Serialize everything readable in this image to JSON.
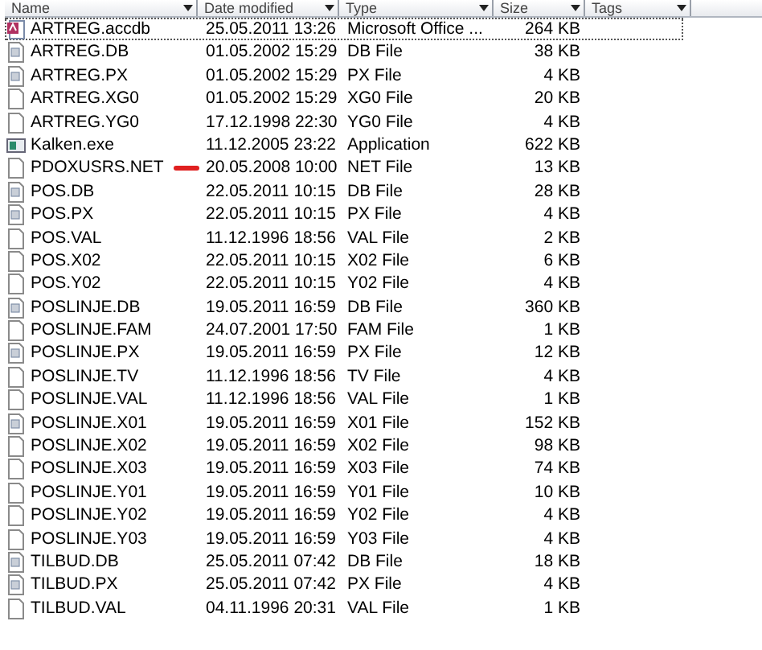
{
  "columns": [
    {
      "label": "Name"
    },
    {
      "label": "Date modified"
    },
    {
      "label": "Type"
    },
    {
      "label": "Size"
    },
    {
      "label": "Tags"
    }
  ],
  "rows": [
    {
      "name": "ARTREG.accdb",
      "date": "25.05.2011 13:26",
      "type": "Microsoft Office ...",
      "size": "264 KB",
      "kind": "access",
      "selected": true,
      "marked": false
    },
    {
      "name": "ARTREG.DB",
      "date": "01.05.2002 15:29",
      "type": "DB File",
      "size": "38 KB",
      "kind": "data",
      "selected": false,
      "marked": false
    },
    {
      "name": "ARTREG.PX",
      "date": "01.05.2002 15:29",
      "type": "PX File",
      "size": "4 KB",
      "kind": "data",
      "selected": false,
      "marked": false
    },
    {
      "name": "ARTREG.XG0",
      "date": "01.05.2002 15:29",
      "type": "XG0 File",
      "size": "20 KB",
      "kind": "blank",
      "selected": false,
      "marked": false
    },
    {
      "name": "ARTREG.YG0",
      "date": "17.12.1998 22:30",
      "type": "YG0 File",
      "size": "4 KB",
      "kind": "blank",
      "selected": false,
      "marked": false
    },
    {
      "name": "Kalken.exe",
      "date": "11.12.2005 23:22",
      "type": "Application",
      "size": "622 KB",
      "kind": "app",
      "selected": false,
      "marked": false
    },
    {
      "name": "PDOXUSRS.NET",
      "date": "20.05.2008 10:00",
      "type": "NET File",
      "size": "13 KB",
      "kind": "blank",
      "selected": false,
      "marked": true
    },
    {
      "name": "POS.DB",
      "date": "22.05.2011 10:15",
      "type": "DB File",
      "size": "28 KB",
      "kind": "data",
      "selected": false,
      "marked": false
    },
    {
      "name": "POS.PX",
      "date": "22.05.2011 10:15",
      "type": "PX File",
      "size": "4 KB",
      "kind": "data",
      "selected": false,
      "marked": false
    },
    {
      "name": "POS.VAL",
      "date": "11.12.1996 18:56",
      "type": "VAL File",
      "size": "2 KB",
      "kind": "blank",
      "selected": false,
      "marked": false
    },
    {
      "name": "POS.X02",
      "date": "22.05.2011 10:15",
      "type": "X02 File",
      "size": "6 KB",
      "kind": "blank",
      "selected": false,
      "marked": false
    },
    {
      "name": "POS.Y02",
      "date": "22.05.2011 10:15",
      "type": "Y02 File",
      "size": "4 KB",
      "kind": "blank",
      "selected": false,
      "marked": false
    },
    {
      "name": "POSLINJE.DB",
      "date": "19.05.2011 16:59",
      "type": "DB File",
      "size": "360 KB",
      "kind": "data",
      "selected": false,
      "marked": false
    },
    {
      "name": "POSLINJE.FAM",
      "date": "24.07.2001 17:50",
      "type": "FAM File",
      "size": "1 KB",
      "kind": "blank",
      "selected": false,
      "marked": false
    },
    {
      "name": "POSLINJE.PX",
      "date": "19.05.2011 16:59",
      "type": "PX File",
      "size": "12 KB",
      "kind": "data",
      "selected": false,
      "marked": false
    },
    {
      "name": "POSLINJE.TV",
      "date": "11.12.1996 18:56",
      "type": "TV File",
      "size": "4 KB",
      "kind": "blank",
      "selected": false,
      "marked": false
    },
    {
      "name": "POSLINJE.VAL",
      "date": "11.12.1996 18:56",
      "type": "VAL File",
      "size": "1 KB",
      "kind": "blank",
      "selected": false,
      "marked": false
    },
    {
      "name": "POSLINJE.X01",
      "date": "19.05.2011 16:59",
      "type": "X01 File",
      "size": "152 KB",
      "kind": "data",
      "selected": false,
      "marked": false
    },
    {
      "name": "POSLINJE.X02",
      "date": "19.05.2011 16:59",
      "type": "X02 File",
      "size": "98 KB",
      "kind": "blank",
      "selected": false,
      "marked": false
    },
    {
      "name": "POSLINJE.X03",
      "date": "19.05.2011 16:59",
      "type": "X03 File",
      "size": "74 KB",
      "kind": "blank",
      "selected": false,
      "marked": false
    },
    {
      "name": "POSLINJE.Y01",
      "date": "19.05.2011 16:59",
      "type": "Y01 File",
      "size": "10 KB",
      "kind": "blank",
      "selected": false,
      "marked": false
    },
    {
      "name": "POSLINJE.Y02",
      "date": "19.05.2011 16:59",
      "type": "Y02 File",
      "size": "4 KB",
      "kind": "blank",
      "selected": false,
      "marked": false
    },
    {
      "name": "POSLINJE.Y03",
      "date": "19.05.2011 16:59",
      "type": "Y03 File",
      "size": "4 KB",
      "kind": "blank",
      "selected": false,
      "marked": false
    },
    {
      "name": "TILBUD.DB",
      "date": "25.05.2011 07:42",
      "type": "DB File",
      "size": "18 KB",
      "kind": "data",
      "selected": false,
      "marked": false
    },
    {
      "name": "TILBUD.PX",
      "date": "25.05.2011 07:42",
      "type": "PX File",
      "size": "4 KB",
      "kind": "data",
      "selected": false,
      "marked": false
    },
    {
      "name": "TILBUD.VAL",
      "date": "04.11.1996 20:31",
      "type": "VAL File",
      "size": "1 KB",
      "kind": "blank",
      "selected": false,
      "marked": false
    }
  ]
}
